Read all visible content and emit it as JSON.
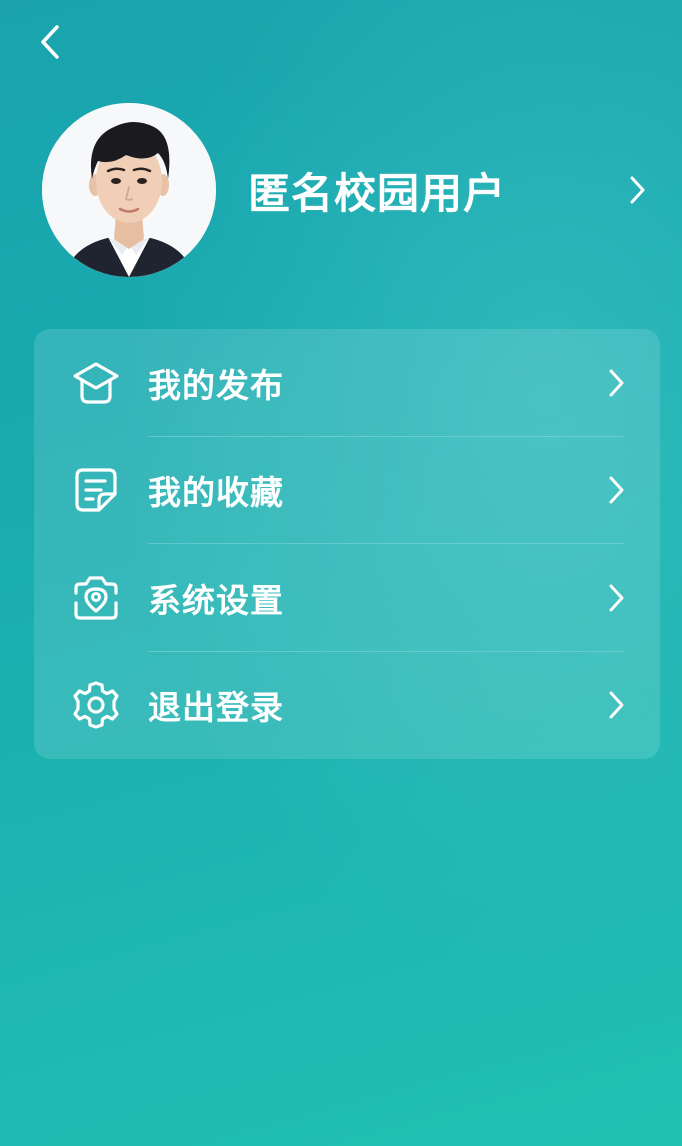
{
  "header": {
    "back_icon": "chevron-left-icon"
  },
  "profile": {
    "avatar": "user-avatar",
    "username": "匿名校园用户",
    "chevron_icon": "chevron-right-icon"
  },
  "menu": {
    "items": [
      {
        "id": "my-posts",
        "label": "我的发布",
        "icon": "mortarboard-icon"
      },
      {
        "id": "my-favorites",
        "label": "我的收藏",
        "icon": "note-icon"
      },
      {
        "id": "system-settings",
        "label": "系统设置",
        "icon": "camera-location-icon"
      },
      {
        "id": "logout",
        "label": "退出登录",
        "icon": "gear-icon"
      }
    ]
  },
  "colors": {
    "background_top": "#1aa3ad",
    "background_bottom": "#22c0b3",
    "text": "#ffffff"
  }
}
